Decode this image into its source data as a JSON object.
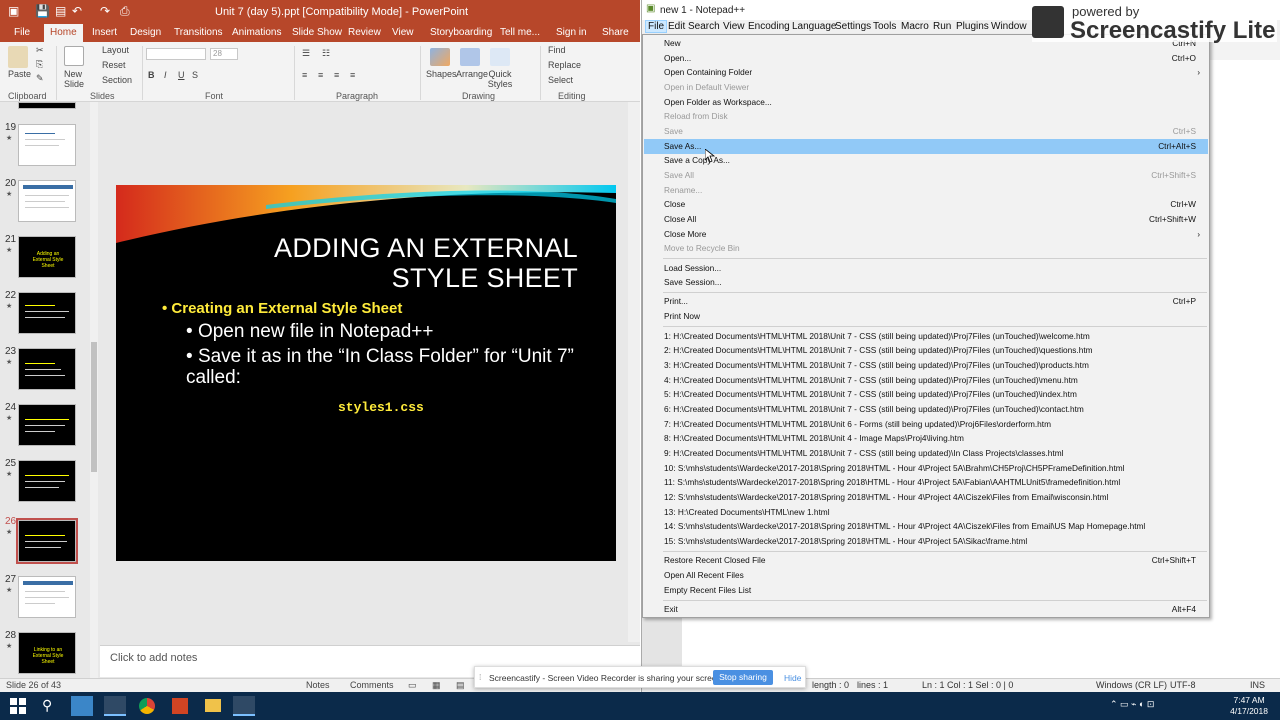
{
  "powerpoint": {
    "title": "Unit 7 (day 5).ppt [Compatibility Mode] - PowerPoint",
    "tabs": [
      "File",
      "Home",
      "Insert",
      "Design",
      "Transitions",
      "Animations",
      "Slide Show",
      "Review",
      "View",
      "Storyboarding",
      "Tell me...",
      "Sign in",
      "Share"
    ],
    "active_tab": "Home",
    "ribbon": {
      "groups": [
        "Clipboard",
        "Slides",
        "Font",
        "Paragraph",
        "Drawing",
        "Editing"
      ],
      "paste": "Paste",
      "new_slide": "New Slide",
      "layout": "Layout",
      "reset": "Reset",
      "section": "Section",
      "font_size": "28",
      "shapes": "Shapes",
      "arrange": "Arrange",
      "quick_styles": "Quick Styles",
      "find": "Find",
      "replace": "Replace",
      "select": "Select"
    },
    "thumbnails": [
      {
        "num": "19",
        "style": "light"
      },
      {
        "num": "20",
        "style": "light"
      },
      {
        "num": "21",
        "style": "dark",
        "text": "Adding an External Style Sheet"
      },
      {
        "num": "22",
        "style": "dark"
      },
      {
        "num": "23",
        "style": "dark"
      },
      {
        "num": "24",
        "style": "dark"
      },
      {
        "num": "25",
        "style": "dark"
      },
      {
        "num": "26",
        "style": "dark",
        "active": true
      },
      {
        "num": "27",
        "style": "light"
      },
      {
        "num": "28",
        "style": "dark",
        "text": "Linking to an External Style Sheet"
      }
    ],
    "slide": {
      "title_line1": "ADDING AN EXTERNAL",
      "title_line2": "STYLE SHEET",
      "bullet1": "Creating an External Style Sheet",
      "bullet2": "Open new file in Notepad++",
      "bullet3": "Save it as in the “In Class Folder” for “Unit 7” called:",
      "code": "styles1.css"
    },
    "notes_placeholder": "Click to add notes",
    "status": {
      "slide_info": "Slide 26 of 43",
      "notes": "Notes",
      "comments": "Comments"
    }
  },
  "notepad": {
    "title": "new 1 - Notepad++",
    "menus": [
      "File",
      "Edit",
      "Search",
      "View",
      "Encoding",
      "Language",
      "Settings",
      "Tools",
      "Macro",
      "Run",
      "Plugins",
      "Window"
    ],
    "active_menu": "File",
    "status": {
      "length": "length : 0",
      "lines": "lines : 1",
      "pos": "Ln : 1    Col : 1    Sel : 0 | 0",
      "eol": "Windows (CR LF)",
      "encoding": "UTF-8",
      "mode": "INS"
    },
    "file_menu": {
      "group1": [
        {
          "label": "New",
          "shortcut": "Ctrl+N"
        },
        {
          "label": "Open...",
          "shortcut": "Ctrl+O"
        },
        {
          "label": "Open Containing Folder",
          "submenu": true
        },
        {
          "label": "Open in Default Viewer",
          "disabled": true
        },
        {
          "label": "Open Folder as Workspace..."
        },
        {
          "label": "Reload from Disk",
          "disabled": true
        },
        {
          "label": "Save",
          "shortcut": "Ctrl+S",
          "disabled": true
        },
        {
          "label": "Save As...",
          "shortcut": "Ctrl+Alt+S",
          "highlighted": true
        },
        {
          "label": "Save a Copy As..."
        },
        {
          "label": "Save All",
          "shortcut": "Ctrl+Shift+S",
          "disabled": true
        },
        {
          "label": "Rename...",
          "disabled": true
        },
        {
          "label": "Close",
          "shortcut": "Ctrl+W"
        },
        {
          "label": "Close All",
          "shortcut": "Ctrl+Shift+W"
        },
        {
          "label": "Close More",
          "submenu": true
        },
        {
          "label": "Move to Recycle Bin",
          "disabled": true
        }
      ],
      "group2": [
        {
          "label": "Load Session..."
        },
        {
          "label": "Save Session..."
        }
      ],
      "group3": [
        {
          "label": "Print...",
          "shortcut": "Ctrl+P"
        },
        {
          "label": "Print Now"
        }
      ],
      "recent": [
        "1: H:\\Created Documents\\HTML\\HTML 2018\\Unit 7 - CSS (still being updated)\\Proj7Files (unTouched)\\welcome.htm",
        "2: H:\\Created Documents\\HTML\\HTML 2018\\Unit 7 - CSS (still being updated)\\Proj7Files (unTouched)\\questions.htm",
        "3: H:\\Created Documents\\HTML\\HTML 2018\\Unit 7 - CSS (still being updated)\\Proj7Files (unTouched)\\products.htm",
        "4: H:\\Created Documents\\HTML\\HTML 2018\\Unit 7 - CSS (still being updated)\\Proj7Files (unTouched)\\menu.htm",
        "5: H:\\Created Documents\\HTML\\HTML 2018\\Unit 7 - CSS (still being updated)\\Proj7Files (unTouched)\\index.htm",
        "6: H:\\Created Documents\\HTML\\HTML 2018\\Unit 7 - CSS (still being updated)\\Proj7Files (unTouched)\\contact.htm",
        "7: H:\\Created Documents\\HTML\\HTML 2018\\Unit 6 - Forms (still being updated)\\Proj6Files\\orderform.htm",
        "8: H:\\Created Documents\\HTML\\HTML 2018\\Unit 4 - Image Maps\\Proj4\\living.htm",
        "9: H:\\Created Documents\\HTML\\HTML 2018\\Unit 7 - CSS (still being updated)\\In Class Projects\\classes.html",
        "10: S:\\mhs\\students\\Wardecke\\2017-2018\\Spring 2018\\HTML - Hour 4\\Project 5A\\Brahm\\CH5Proj\\CH5PFrameDefinition.html",
        "11: S:\\mhs\\students\\Wardecke\\2017-2018\\Spring 2018\\HTML - Hour 4\\Project 5A\\Fabian\\AAHTMLUnit5\\framedefinition.html",
        "12: S:\\mhs\\students\\Wardecke\\2017-2018\\Spring 2018\\HTML - Hour 4\\Project 4A\\Ciszek\\Files from Email\\wisconsin.html",
        "13: H:\\Created Documents\\HTML\\new 1.html",
        "14: S:\\mhs\\students\\Wardecke\\2017-2018\\Spring 2018\\HTML - Hour 4\\Project 4A\\Ciszek\\Files from Email\\US Map Homepage.html",
        "15: S:\\mhs\\students\\Wardecke\\2017-2018\\Spring 2018\\HTML - Hour 4\\Project 5A\\Sikac\\frame.html"
      ],
      "group5": [
        {
          "label": "Restore Recent Closed File",
          "shortcut": "Ctrl+Shift+T"
        },
        {
          "label": "Open All Recent Files"
        },
        {
          "label": "Empty Recent Files List"
        }
      ],
      "exit": {
        "label": "Exit",
        "shortcut": "Alt+F4"
      }
    }
  },
  "overlay": {
    "watermark_small": "powered by",
    "watermark_big": "Screencastify Lite",
    "share_text": "Screencastify - Screen Video Recorder is sharing your screen.",
    "stop_label": "Stop sharing",
    "hide_label": "Hide"
  },
  "taskbar": {
    "time": "7:47 AM",
    "date": "4/17/2018"
  },
  "colors": {
    "ppt_accent": "#b7472a",
    "menu_highlight": "#91c9f7",
    "slide_yellow": "#ffeb3b",
    "taskbar": "#0b2a4a"
  }
}
